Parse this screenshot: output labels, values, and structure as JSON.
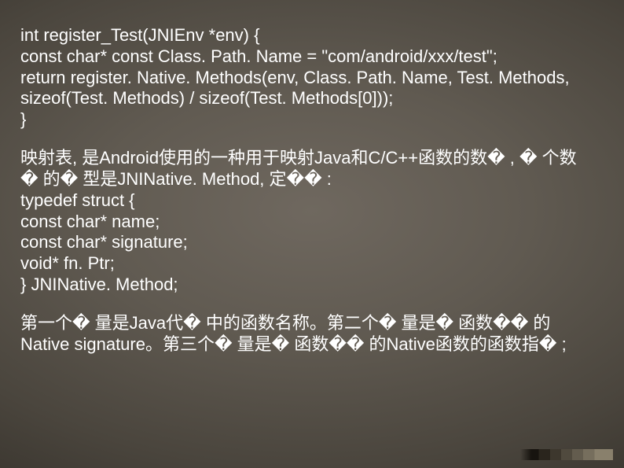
{
  "block1": {
    "l1": "int register_Test(JNIEnv *env) {",
    "l2": "const char* const Class. Path. Name = \"com/android/xxx/test\";",
    "l3": "return register. Native. Methods(env, Class. Path. Name, Test. Methods,",
    "l4": "sizeof(Test. Methods) / sizeof(Test. Methods[0]));",
    "l5": "}"
  },
  "block2": {
    "l1": "映射表, 是Android使用的一种用于映射Java和C/C++函数的数� , � 个数",
    "l2": "� 的� 型是JNINative. Method, 定�� :",
    "l3": "typedef struct {",
    "l4": "const char* name;",
    "l5": "const char* signature;",
    "l6": "void* fn. Ptr;",
    "l7": "} JNINative. Method;"
  },
  "block3": {
    "l1": "第一个� 量是Java代� 中的函数名称。第二个� 量是� 函数�� 的",
    "l2": "Native signature。第三个� 量是� 函数�� 的Native函数的函数指� ;"
  }
}
